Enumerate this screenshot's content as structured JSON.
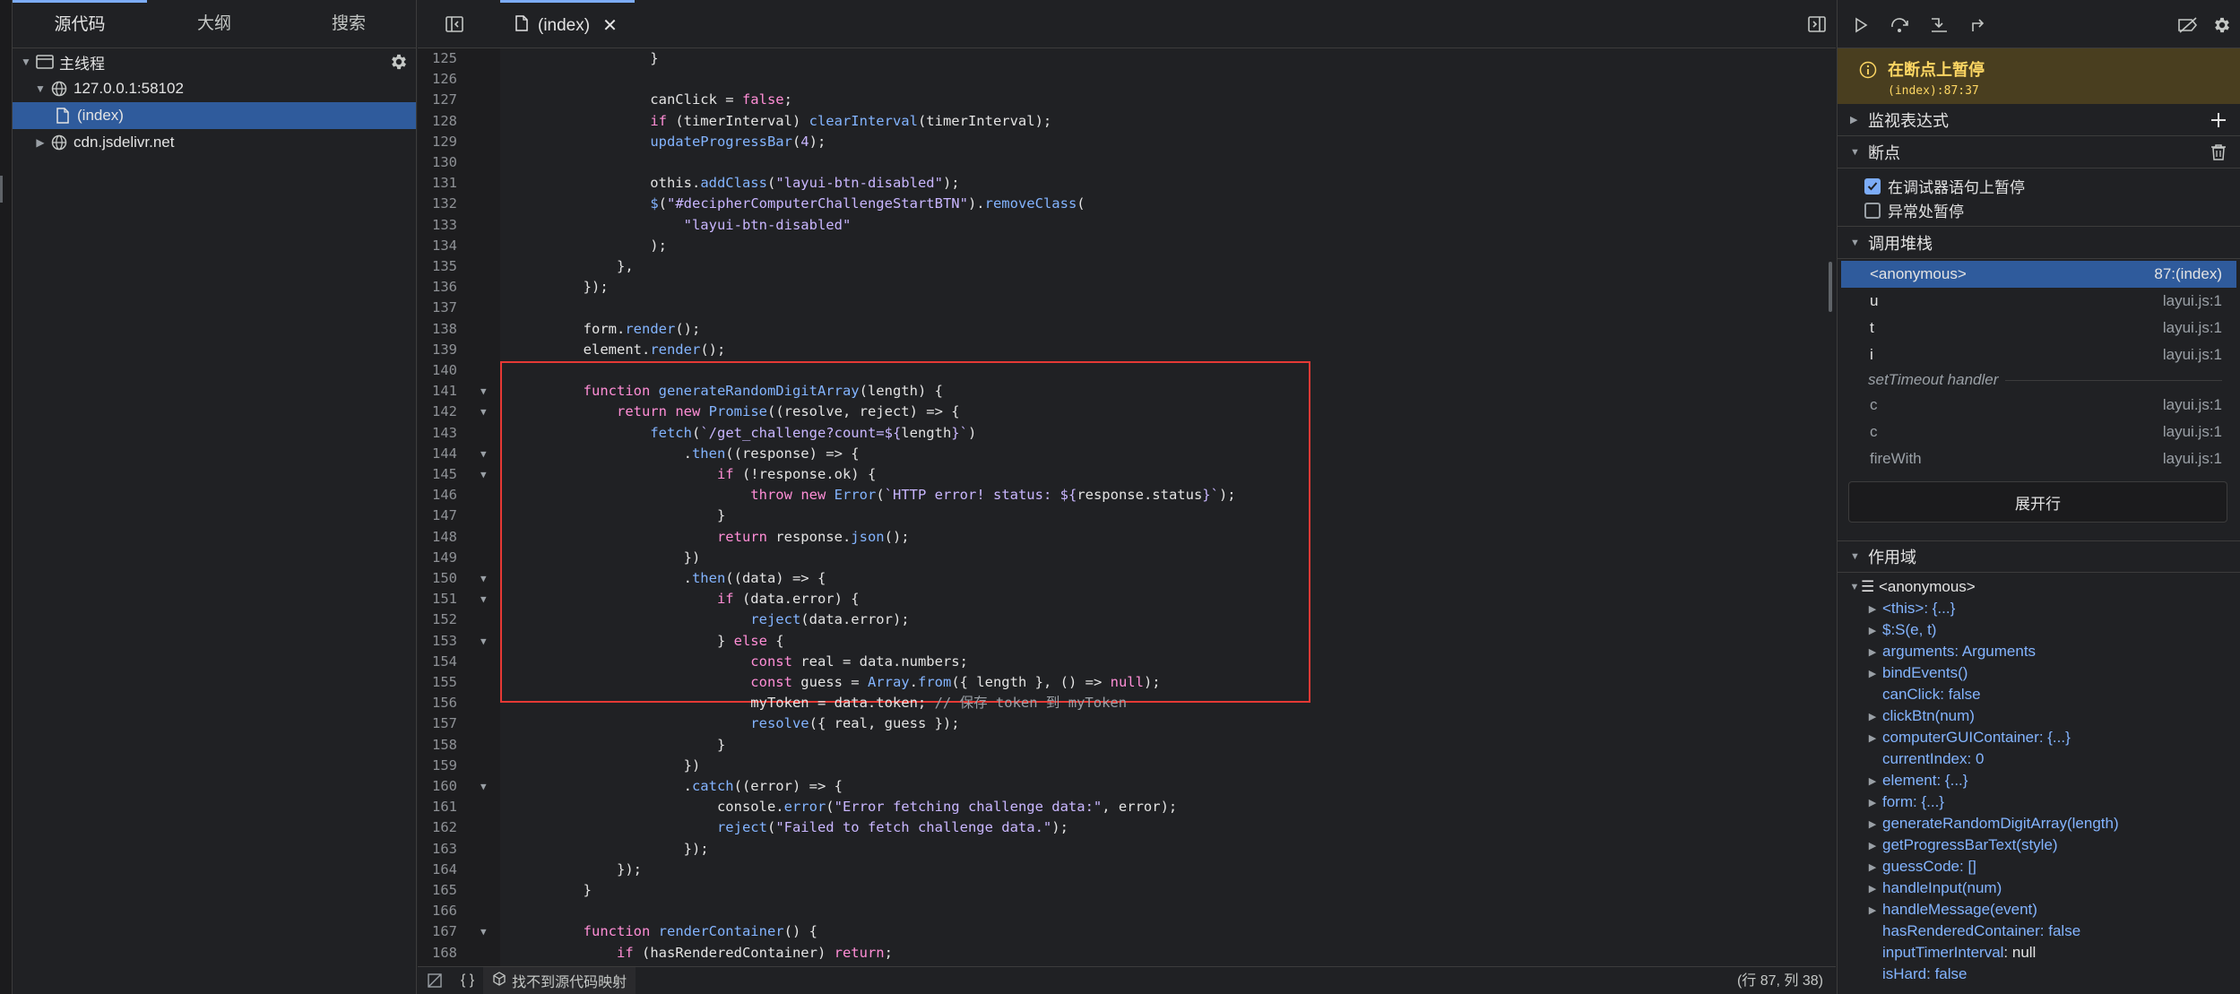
{
  "navigator": {
    "tabs": [
      "源代码",
      "大纲",
      "搜索"
    ],
    "tree": [
      {
        "label": "主线程",
        "icon": "frame-icon",
        "expanded": true
      },
      {
        "label": "127.0.0.1:58102",
        "icon": "globe-icon",
        "expanded": true
      },
      {
        "label": "(index)",
        "icon": "file-icon",
        "selected": true
      },
      {
        "label": "cdn.jsdelivr.net",
        "icon": "globe-icon",
        "expanded": false
      }
    ]
  },
  "editor": {
    "tab_label": "(index)",
    "code_lines": [
      {
        "n": "125",
        "fold": false,
        "html": "                }"
      },
      {
        "n": "126",
        "fold": false,
        "html": ""
      },
      {
        "n": "127",
        "fold": false,
        "html": "                canClick = <span class=\"kw\">false</span>;"
      },
      {
        "n": "128",
        "fold": false,
        "html": "                <span class=\"kw\">if</span> (timerInterval) <span class=\"fn\">clearInterval</span>(timerInterval);"
      },
      {
        "n": "129",
        "fold": false,
        "html": "                <span class=\"fn\">updateProgressBar</span>(<span class=\"num\">4</span>);"
      },
      {
        "n": "130",
        "fold": false,
        "html": ""
      },
      {
        "n": "131",
        "fold": false,
        "html": "                othis.<span class=\"fn\">addClass</span>(<span class=\"str\">\"layui-btn-disabled\"</span>);"
      },
      {
        "n": "132",
        "fold": false,
        "html": "                <span class=\"fn\">$</span>(<span class=\"str\">\"#decipherComputerChallengeStartBTN\"</span>).<span class=\"fn\">removeClass</span>("
      },
      {
        "n": "133",
        "fold": false,
        "html": "                    <span class=\"str\">\"layui-btn-disabled\"</span>"
      },
      {
        "n": "134",
        "fold": false,
        "html": "                );"
      },
      {
        "n": "135",
        "fold": false,
        "html": "            },"
      },
      {
        "n": "136",
        "fold": false,
        "html": "        });"
      },
      {
        "n": "137",
        "fold": false,
        "html": ""
      },
      {
        "n": "138",
        "fold": false,
        "html": "        form.<span class=\"fn\">render</span>();"
      },
      {
        "n": "139",
        "fold": false,
        "html": "        element.<span class=\"fn\">render</span>();"
      },
      {
        "n": "140",
        "fold": false,
        "html": ""
      },
      {
        "n": "141",
        "fold": true,
        "html": "        <span class=\"kw\">function</span> <span class=\"fn\">generateRandomDigitArray</span>(length) {"
      },
      {
        "n": "142",
        "fold": true,
        "html": "            <span class=\"kw\">return</span> <span class=\"kw\">new</span> <span class=\"fn\">Promise</span>((resolve, reject) =&gt; {"
      },
      {
        "n": "143",
        "fold": false,
        "html": "                <span class=\"fn\">fetch</span>(<span class=\"str\">`/get_challenge?count=${</span>length<span class=\"str\">}`</span>)"
      },
      {
        "n": "144",
        "fold": true,
        "html": "                    .<span class=\"fn\">then</span>((response) =&gt; {"
      },
      {
        "n": "145",
        "fold": true,
        "html": "                        <span class=\"kw\">if</span> (!response.ok) {"
      },
      {
        "n": "146",
        "fold": false,
        "html": "                            <span class=\"kw\">throw</span> <span class=\"kw\">new</span> <span class=\"fn\">Error</span>(<span class=\"str\">`HTTP error! status: ${</span>response.status<span class=\"str\">}`</span>);"
      },
      {
        "n": "147",
        "fold": false,
        "html": "                        }"
      },
      {
        "n": "148",
        "fold": false,
        "html": "                        <span class=\"kw\">return</span> response.<span class=\"fn\">json</span>();"
      },
      {
        "n": "149",
        "fold": false,
        "html": "                    })"
      },
      {
        "n": "150",
        "fold": true,
        "html": "                    .<span class=\"fn\">then</span>((data) =&gt; {"
      },
      {
        "n": "151",
        "fold": true,
        "html": "                        <span class=\"kw\">if</span> (data.error) {"
      },
      {
        "n": "152",
        "fold": false,
        "html": "                            <span class=\"fn\">reject</span>(data.error);"
      },
      {
        "n": "153",
        "fold": true,
        "html": "                        } <span class=\"kw\">else</span> {"
      },
      {
        "n": "154",
        "fold": false,
        "html": "                            <span class=\"kw\">const</span> real = data.numbers;"
      },
      {
        "n": "155",
        "fold": false,
        "html": "                            <span class=\"kw\">const</span> guess = <span class=\"fn\">Array</span>.<span class=\"fn\">from</span>({ length }, () =&gt; <span class=\"kw\">null</span>);"
      },
      {
        "n": "156",
        "fold": false,
        "html": "                            myToken = data.token; <span class=\"cm\">// 保存 token 到 myToken</span>"
      },
      {
        "n": "157",
        "fold": false,
        "html": "                            <span class=\"fn\">resolve</span>({ real, guess });"
      },
      {
        "n": "158",
        "fold": false,
        "html": "                        }"
      },
      {
        "n": "159",
        "fold": false,
        "html": "                    })"
      },
      {
        "n": "160",
        "fold": true,
        "html": "                    .<span class=\"fn\">catch</span>((error) =&gt; {"
      },
      {
        "n": "161",
        "fold": false,
        "html": "                        console.<span class=\"fn\">error</span>(<span class=\"str\">\"Error fetching challenge data:\"</span>, error);"
      },
      {
        "n": "162",
        "fold": false,
        "html": "                        <span class=\"fn\">reject</span>(<span class=\"str\">\"Failed to fetch challenge data.\"</span>);"
      },
      {
        "n": "163",
        "fold": false,
        "html": "                    });"
      },
      {
        "n": "164",
        "fold": false,
        "html": "            });"
      },
      {
        "n": "165",
        "fold": false,
        "html": "        }"
      },
      {
        "n": "166",
        "fold": false,
        "html": ""
      },
      {
        "n": "167",
        "fold": true,
        "html": "        <span class=\"kw\">function</span> <span class=\"fn\">renderContainer</span>() {"
      },
      {
        "n": "168",
        "fold": false,
        "html": "            <span class=\"kw\">if</span> (hasRenderedContainer) <span class=\"kw\">return</span>;"
      }
    ],
    "status": {
      "source_map": "找不到源代码映射",
      "position": "(行 87, 列 38)"
    }
  },
  "debugger": {
    "paused_title": "在断点上暂停",
    "paused_location": "(index):87:37",
    "watch_label": "监视表达式",
    "breakpoints_label": "断点",
    "pause_on_debugger": "在调试器语句上暂停",
    "pause_on_exceptions": "异常处暂停",
    "call_stack_label": "调用堆栈",
    "call_stack": [
      {
        "fn": "<anonymous>",
        "loc": "87:(index)",
        "selected": true
      },
      {
        "fn": "u",
        "loc": "layui.js:1"
      },
      {
        "fn": "t",
        "loc": "layui.js:1"
      },
      {
        "fn": "i",
        "loc": "layui.js:1"
      }
    ],
    "async_label": "setTimeout handler",
    "async_stack": [
      {
        "fn": "c",
        "loc": "layui.js:1"
      },
      {
        "fn": "c",
        "loc": "layui.js:1"
      },
      {
        "fn": "fireWith",
        "loc": "layui.js:1"
      }
    ],
    "expand_rows": "展开行",
    "scope_label": "作用域",
    "scope_root": "☰ <anonymous>",
    "scope": [
      {
        "key": "<this>",
        "val": ": {...}",
        "expandable": true,
        "vtype": "obj"
      },
      {
        "key": "$:S(e, t)",
        "val": "",
        "expandable": true,
        "vtype": "obj"
      },
      {
        "key": "arguments",
        "val": ": Arguments",
        "expandable": true,
        "vtype": "obj"
      },
      {
        "key": "bindEvents()",
        "val": "",
        "expandable": true,
        "vtype": "obj"
      },
      {
        "key": "canClick",
        "val": ": false",
        "expandable": false,
        "vtype": "bool"
      },
      {
        "key": "clickBtn(num)",
        "val": "",
        "expandable": true,
        "vtype": "obj"
      },
      {
        "key": "computerGUIContainer",
        "val": ": {...}",
        "expandable": true,
        "vtype": "obj"
      },
      {
        "key": "currentIndex",
        "val": ": 0",
        "expandable": false,
        "vtype": "num"
      },
      {
        "key": "element",
        "val": ": {...}",
        "expandable": true,
        "vtype": "obj"
      },
      {
        "key": "form",
        "val": ": {...}",
        "expandable": true,
        "vtype": "obj"
      },
      {
        "key": "generateRandomDigitArray(length)",
        "val": "",
        "expandable": true,
        "vtype": "obj"
      },
      {
        "key": "getProgressBarText(style)",
        "val": "",
        "expandable": true,
        "vtype": "obj"
      },
      {
        "key": "guessCode",
        "val": ": []",
        "expandable": true,
        "vtype": "obj"
      },
      {
        "key": "handleInput(num)",
        "val": "",
        "expandable": true,
        "vtype": "obj"
      },
      {
        "key": "handleMessage(event)",
        "val": "",
        "expandable": true,
        "vtype": "obj"
      },
      {
        "key": "hasRenderedContainer",
        "val": ": false",
        "expandable": false,
        "vtype": "bool"
      },
      {
        "key": "inputTimerInterval",
        "val": ": null",
        "expandable": false,
        "vtype": "null"
      },
      {
        "key": "isHard",
        "val": ": false",
        "expandable": false,
        "vtype": "bool"
      }
    ]
  }
}
